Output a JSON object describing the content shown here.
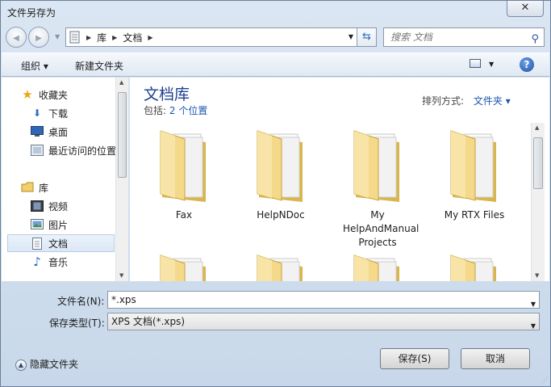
{
  "window": {
    "title": "文件另存为",
    "close_label": "✕"
  },
  "nav": {
    "back_glyph": "◀",
    "forward_glyph": "▶",
    "breadcrumb": [
      "库",
      "文档"
    ],
    "search_placeholder": "搜索 文档"
  },
  "toolbar": {
    "organize": "组织 ▾",
    "new_folder": "新建文件夹",
    "help": "?"
  },
  "sidebar": {
    "items": [
      {
        "label": "收藏夹",
        "icon": "star-icon"
      },
      {
        "label": "下载",
        "icon": "download-folder-icon"
      },
      {
        "label": "桌面",
        "icon": "desktop-icon"
      },
      {
        "label": "最近访问的位置",
        "icon": "recent-places-icon"
      },
      {
        "label": "库",
        "icon": "library-icon"
      },
      {
        "label": "视频",
        "icon": "video-icon"
      },
      {
        "label": "图片",
        "icon": "pictures-icon"
      },
      {
        "label": "文档",
        "icon": "documents-icon",
        "selected": true
      },
      {
        "label": "音乐",
        "icon": "music-icon"
      }
    ]
  },
  "content": {
    "title": "文档库",
    "includes_label": "包括:",
    "includes_link": "2 个位置",
    "arrange_label": "排列方式:",
    "arrange_value": "文件夹 ▾",
    "folders": [
      "Fax",
      "HelpNDoc",
      "My HelpAndManual Projects",
      "My RTX Files",
      "",
      "",
      "",
      ""
    ]
  },
  "form": {
    "filename_label": "文件名(N):",
    "filename_value": "*.xps",
    "filetype_label": "保存类型(T):",
    "filetype_value": "XPS 文档(*.xps)"
  },
  "footer": {
    "hide_folders": "隐藏文件夹",
    "save": "保存(S)",
    "cancel": "取消"
  }
}
